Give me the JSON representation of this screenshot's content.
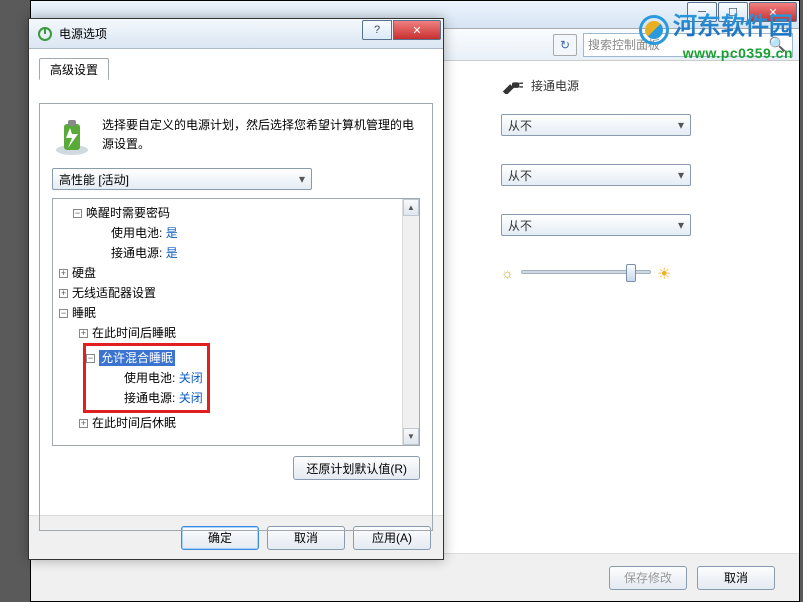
{
  "bgWindow": {
    "searchPlaceholder": "搜索控制面板",
    "pluggedLabel": "接通电源",
    "options": {
      "never": "从不"
    },
    "footer": {
      "save": "保存修改",
      "cancel": "取消"
    }
  },
  "dialog": {
    "title": "电源选项",
    "tab": "高级设置",
    "description": "选择要自定义的电源计划，然后选择您希望计算机管理的电源设置。",
    "planSelect": "高性能 [活动]",
    "tree": {
      "wakePassword": {
        "label": "唤醒时需要密码",
        "battery": "使用电池:",
        "batteryVal": "是",
        "plugged": "接通电源:",
        "pluggedVal": "是"
      },
      "hdd": "硬盘",
      "wireless": "无线适配器设置",
      "sleep": {
        "label": "睡眠",
        "afterSleep": "在此时间后睡眠",
        "hybrid": {
          "label": "允许混合睡眠",
          "battery": "使用电池:",
          "batteryVal": "关闭",
          "plugged": "接通电源:",
          "pluggedVal": "关闭"
        },
        "afterHibernate": "在此时间后休眠"
      }
    },
    "restoreDefaults": "还原计划默认值(R)",
    "buttons": {
      "ok": "确定",
      "cancel": "取消",
      "apply": "应用(A)"
    }
  },
  "watermark": {
    "cn": "河东软件园",
    "url": "www.pc0359.cn"
  }
}
